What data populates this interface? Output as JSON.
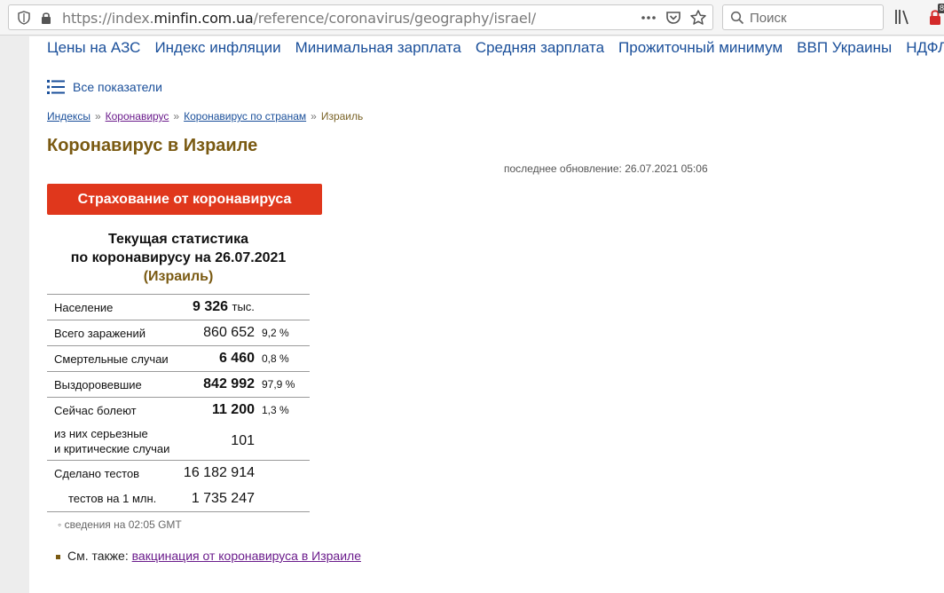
{
  "browser": {
    "url_prefix": "https://index.",
    "url_host": "minfin.com.ua",
    "url_path": "/reference/coronavirus/geography/israel/",
    "search_placeholder": "Поиск",
    "badge": "8"
  },
  "topnav": [
    "Цены на АЗС",
    "Индекс инфляции",
    "Минимальная зарплата",
    "Средняя зарплата",
    "Прожиточный минимум",
    "ВВП Украины",
    "НДФЛ"
  ],
  "all_indicators": "Все показатели",
  "breadcrumbs": {
    "items": [
      "Индексы",
      "Коронавирус",
      "Коронавирус по странам"
    ],
    "separator": "»",
    "current": "Израиль"
  },
  "page_title": "Коронавирус в Израиле",
  "updated": "последнее обновление: 26.07.2021 05:06",
  "insurance_button": "Страхование от коронавируса",
  "stats": {
    "title_line1": "Текущая статистика",
    "title_line2": "по коронавирусу на 26.07.2021",
    "country": "(Израиль)",
    "population_label": "Население",
    "population_value": "9 326",
    "population_unit": "тыс.",
    "infected_label": "Всего заражений",
    "infected_value": "860 652",
    "infected_pct": "9,2 %",
    "deaths_label": "Смертельные случаи",
    "deaths_value": "6 460",
    "deaths_pct": "0,8 %",
    "recovered_label": "Выздоровевшие",
    "recovered_value": "842 992",
    "recovered_pct": "97,9 %",
    "sick_label": "Сейчас болеют",
    "sick_value": "11 200",
    "sick_pct": "1,3 %",
    "critical_label_1": "из них серьезные",
    "critical_label_2": "и критические случаи",
    "critical_value": "101",
    "tests_label": "Сделано тестов",
    "tests_value": "16 182 914",
    "tests_per_million_label": "тестов на 1 млн.",
    "tests_per_million_value": "1 735 247"
  },
  "source_note": "сведения на 02:05 GMT",
  "see_also_prefix": "См. также:",
  "see_also_link": "вакцинация от коронавируса в Израиле",
  "colors": {
    "link": "#1a4f9a",
    "title": "#7a5a12",
    "button": "#e0371c"
  }
}
